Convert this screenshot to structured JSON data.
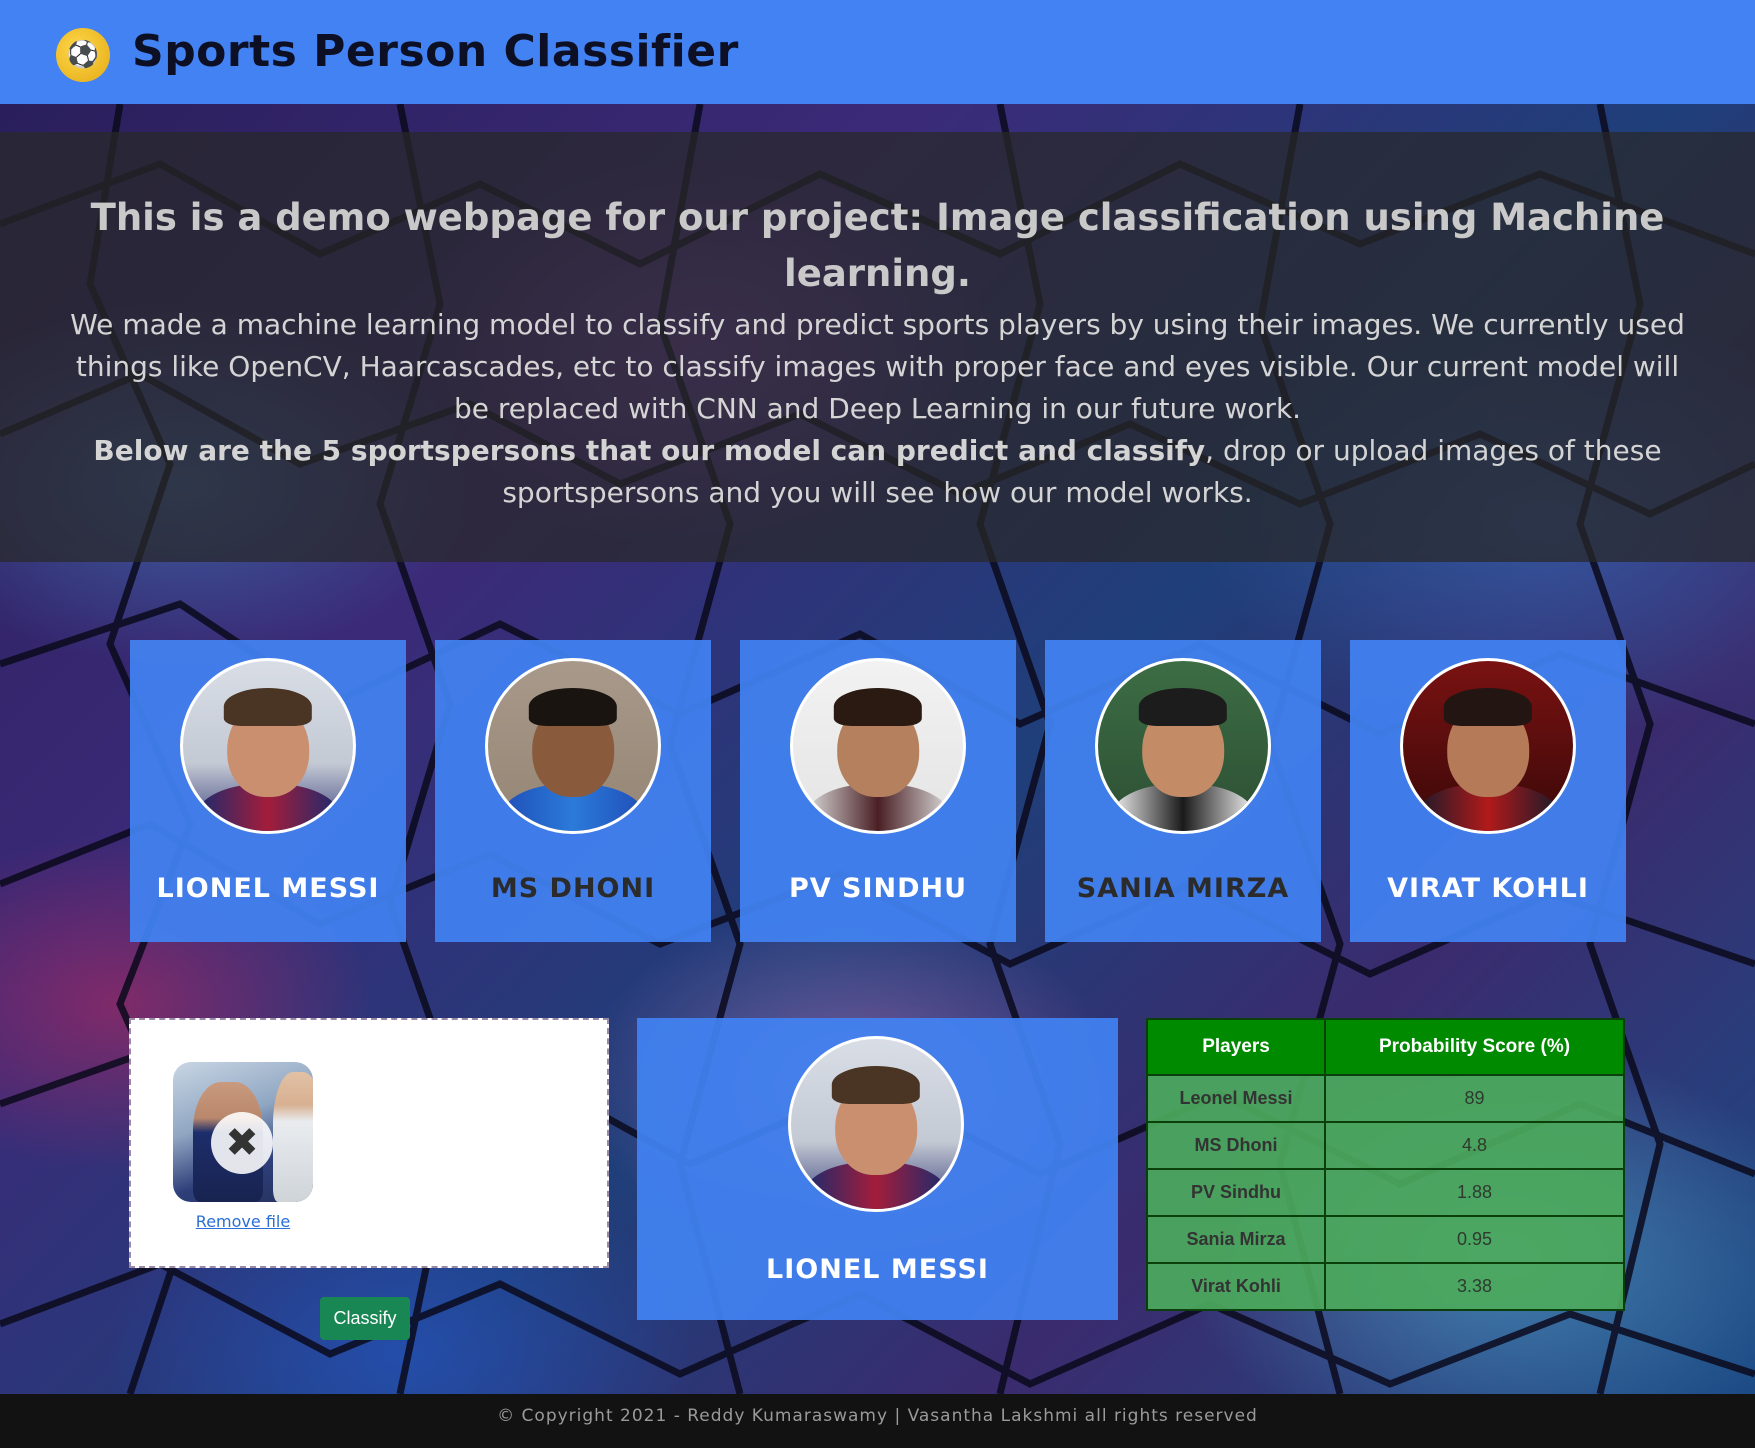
{
  "header": {
    "title": "Sports Person Classifier",
    "logo_icon": "athlete-logo-icon"
  },
  "intro": {
    "heading": "This is a demo webpage for our project: Image classification using Machine learning.",
    "paragraph": "We made a machine learning model to classify and predict sports players by using their images. We currently used things like OpenCV, Haarcascades, etc to classify images with proper face and eyes visible. Our current model will be replaced with CNN and Deep Learning in our future work.",
    "bold_lead": "Below are the 5 sportspersons that our model can predict and classify",
    "tail": ", drop or upload images of these sportspersons and you will see how our model works."
  },
  "players": [
    {
      "name": "LIONEL MESSI",
      "label_color": "#ffffff"
    },
    {
      "name": "MS DHONI",
      "label_color": "#2b2b2b"
    },
    {
      "name": "PV SINDHU",
      "label_color": "#ffffff"
    },
    {
      "name": "SANIA MIRZA",
      "label_color": "#2b2b2b"
    },
    {
      "name": "VIRAT KOHLI",
      "label_color": "#ffffff"
    }
  ],
  "upload": {
    "remove_label": "Remove file",
    "classify_label": "Classify"
  },
  "result": {
    "name": "LIONEL MESSI"
  },
  "scores": {
    "headers": [
      "Players",
      "Probability Score (%)"
    ],
    "rows": [
      {
        "player": "Leonel Messi",
        "score": "89"
      },
      {
        "player": "MS Dhoni",
        "score": "4.8"
      },
      {
        "player": "PV Sindhu",
        "score": "1.88"
      },
      {
        "player": "Sania Mirza",
        "score": "0.95"
      },
      {
        "player": "Virat Kohli",
        "score": "3.38"
      }
    ]
  },
  "footer": {
    "text": "© Copyright 2021 - Reddy Kumaraswamy | Vasantha Lakshmi all rights reserved"
  },
  "colors": {
    "header_bg": "#4282f2",
    "card_bg": "#4282f2",
    "table_header": "#008a00",
    "classify_button": "#198754"
  }
}
